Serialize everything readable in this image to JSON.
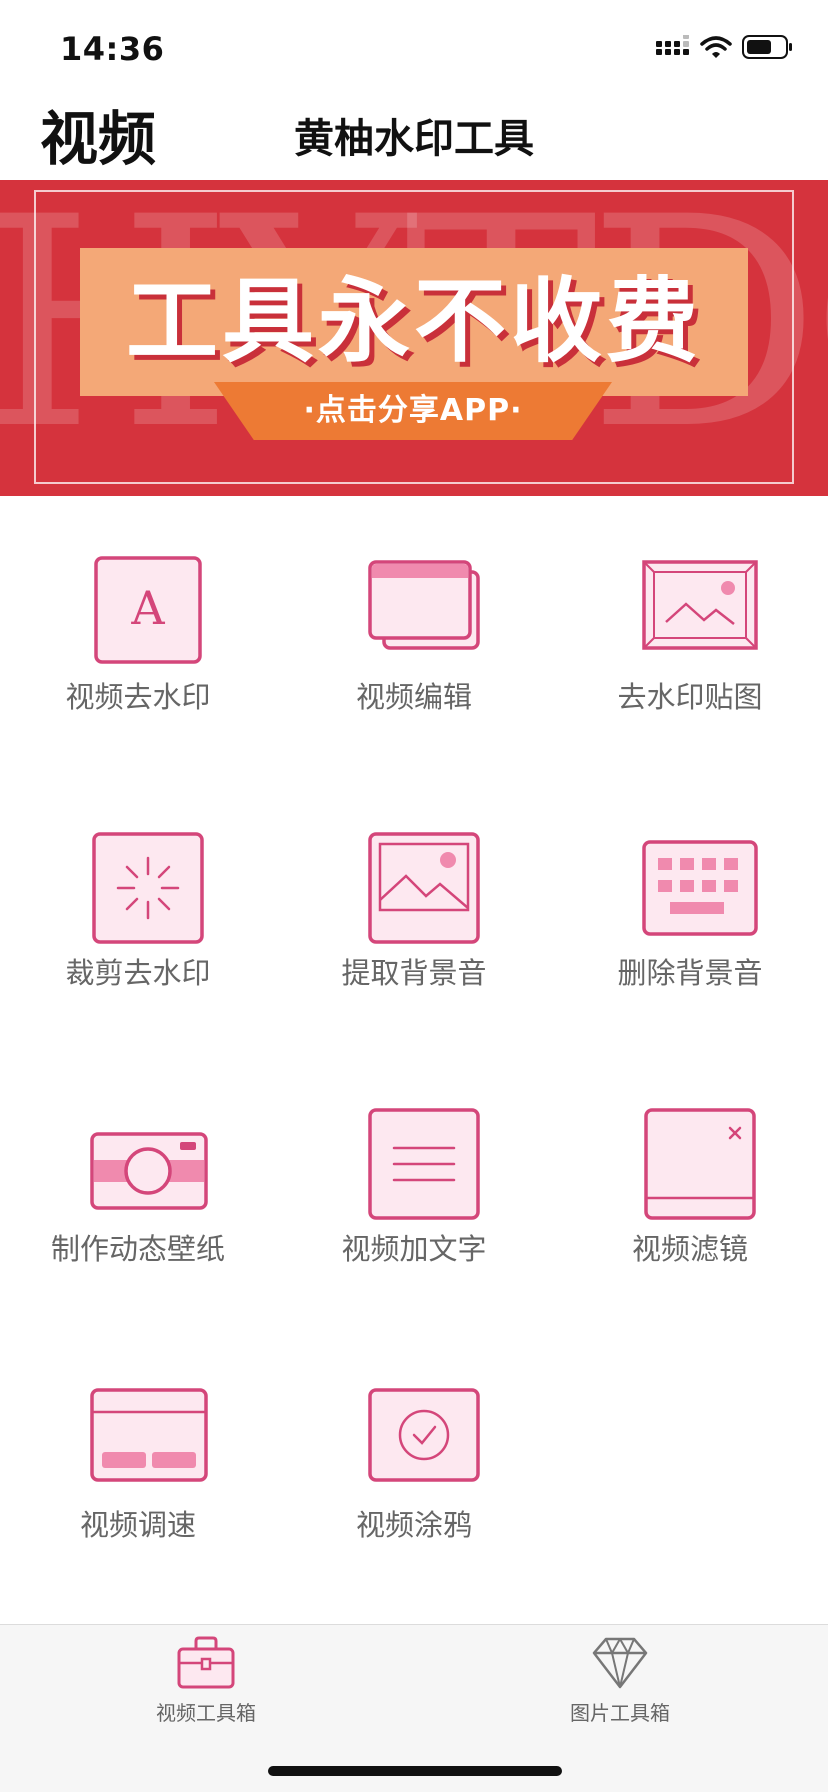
{
  "status_bar": {
    "time": "14:36",
    "icons": [
      "signal-icon",
      "wifi-icon",
      "battery-icon"
    ]
  },
  "header": {
    "page_title": "视频",
    "app_title": "黄柚水印工具"
  },
  "banner": {
    "watermark": "HYTDC",
    "headline": "工具永不收费",
    "cta": "·点击分享APP·",
    "colors": {
      "background": "#d5333d",
      "plate": "#f4a877",
      "ribbon": "#ed7a34"
    }
  },
  "tools": [
    {
      "label": "视频去水印",
      "icon": "letter-a-icon"
    },
    {
      "label": "视频编辑",
      "icon": "stacked-windows-icon"
    },
    {
      "label": "去水印贴图",
      "icon": "framed-picture-icon"
    },
    {
      "label": "裁剪去水印",
      "icon": "sparkle-icon"
    },
    {
      "label": "提取背景音",
      "icon": "image-icon"
    },
    {
      "label": "删除背景音",
      "icon": "keyboard-icon"
    },
    {
      "label": "制作动态壁纸",
      "icon": "camera-icon"
    },
    {
      "label": "视频加文字",
      "icon": "text-lines-icon"
    },
    {
      "label": "视频滤镜",
      "icon": "close-card-icon"
    },
    {
      "label": "视频调速",
      "icon": "window-bars-icon"
    },
    {
      "label": "视频涂鸦",
      "icon": "check-circle-icon"
    }
  ],
  "tab_bar": {
    "tabs": [
      {
        "label": "视频工具箱",
        "icon": "toolbox-icon",
        "active": true
      },
      {
        "label": "图片工具箱",
        "icon": "diamond-icon",
        "active": false
      }
    ]
  },
  "colors": {
    "icon_stroke": "#d4467a",
    "icon_fill": "#fde8f0",
    "icon_accent": "#f08aae",
    "label": "#666666"
  }
}
